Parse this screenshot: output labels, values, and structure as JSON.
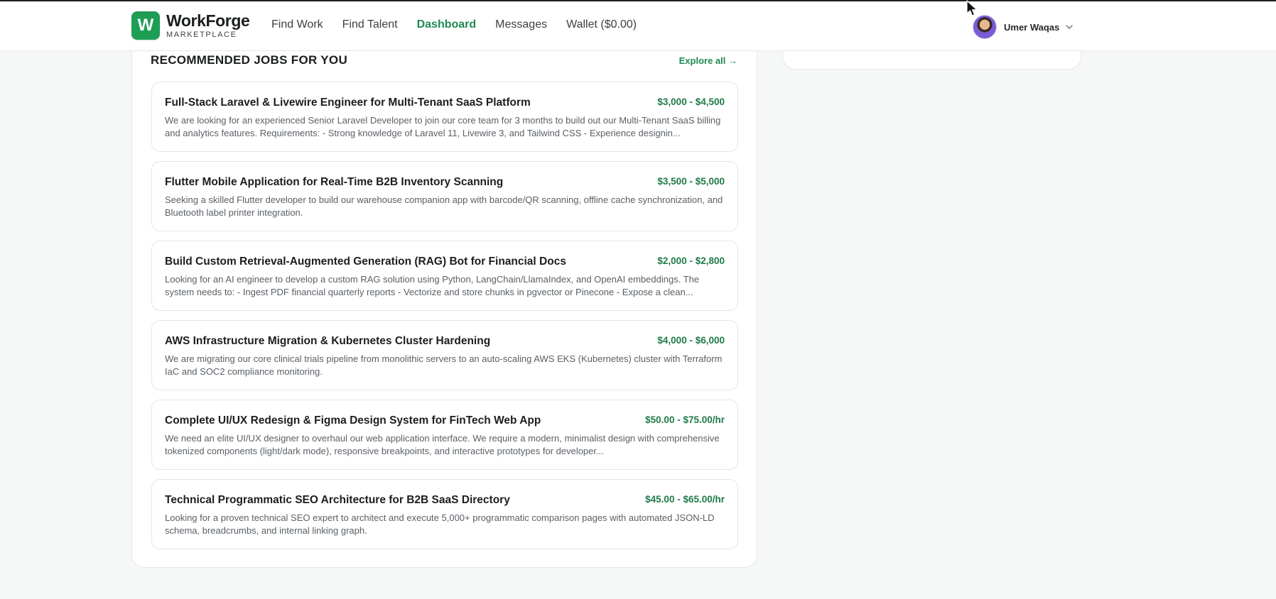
{
  "brand": {
    "letter": "W",
    "name": "WorkForge",
    "subtitle": "MARKETPLACE",
    "color": "#1f9d55"
  },
  "nav": [
    {
      "label": "Find Work",
      "active": false
    },
    {
      "label": "Find Talent",
      "active": false
    },
    {
      "label": "Dashboard",
      "active": true
    },
    {
      "label": "Messages",
      "active": false
    },
    {
      "label": "Wallet ($0.00)",
      "active": false
    }
  ],
  "user": {
    "name": "Umer Waqas",
    "icon": "chevron-down-icon"
  },
  "section": {
    "title": "RECOMMENDED JOBS FOR YOU",
    "explore_label": "Explore all →"
  },
  "jobs": [
    {
      "title": "Full-Stack Laravel & Livewire Engineer for Multi-Tenant SaaS Platform",
      "rate": "$3,000 - $4,500",
      "description": "We are looking for an experienced Senior Laravel Developer to join our core team for 3 months to build out our Multi-Tenant SaaS billing and analytics features. Requirements: - Strong knowledge of Laravel 11, Livewire 3, and Tailwind CSS - Experience designin..."
    },
    {
      "title": "Flutter Mobile Application for Real-Time B2B Inventory Scanning",
      "rate": "$3,500 - $5,000",
      "description": "Seeking a skilled Flutter developer to build our warehouse companion app with barcode/QR scanning, offline cache synchronization, and Bluetooth label printer integration."
    },
    {
      "title": "Build Custom Retrieval-Augmented Generation (RAG) Bot for Financial Docs",
      "rate": "$2,000 - $2,800",
      "description": "Looking for an AI engineer to develop a custom RAG solution using Python, LangChain/LlamaIndex, and OpenAI embeddings. The system needs to: - Ingest PDF financial quarterly reports - Vectorize and store chunks in pgvector or Pinecone - Expose a clean..."
    },
    {
      "title": "AWS Infrastructure Migration & Kubernetes Cluster Hardening",
      "rate": "$4,000 - $6,000",
      "description": "We are migrating our core clinical trials pipeline from monolithic servers to an auto-scaling AWS EKS (Kubernetes) cluster with Terraform IaC and SOC2 compliance monitoring."
    },
    {
      "title": "Complete UI/UX Redesign & Figma Design System for FinTech Web App",
      "rate": "$50.00 - $75.00/hr",
      "description": "We need an elite UI/UX designer to overhaul our web application interface. We require a modern, minimalist design with comprehensive tokenized components (light/dark mode), responsive breakpoints, and interactive prototypes for developer..."
    },
    {
      "title": "Technical Programmatic SEO Architecture for B2B SaaS Directory",
      "rate": "$45.00 - $65.00/hr",
      "description": "Looking for a proven technical SEO expert to architect and execute 5,000+ programmatic comparison pages with automated JSON-LD schema, breadcrumbs, and internal linking graph."
    }
  ]
}
